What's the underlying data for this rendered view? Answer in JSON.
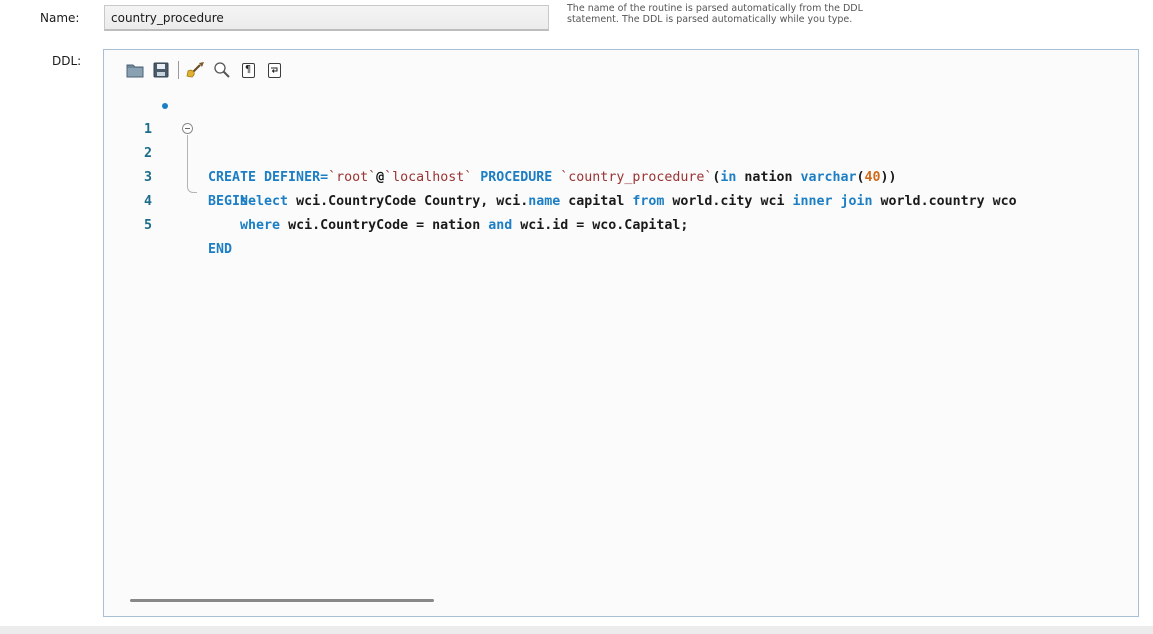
{
  "form": {
    "name_label": "Name:",
    "name_value": "country_procedure",
    "hint_line1": "The name of the routine is parsed automatically from the DDL",
    "hint_line2": "statement. The DDL is parsed automatically while you type.",
    "ddl_label": "DDL:"
  },
  "toolbar": {
    "buttons": [
      {
        "name": "open-file-icon"
      },
      {
        "name": "save-icon"
      },
      {
        "name": "beautify-icon"
      },
      {
        "name": "find-icon"
      },
      {
        "name": "show-whitespace-icon",
        "glyph": "¶"
      },
      {
        "name": "word-wrap-icon",
        "glyph": "⮐"
      }
    ]
  },
  "editor": {
    "line_numbers": [
      "1",
      "2",
      "3",
      "4",
      "5"
    ],
    "lines": [
      [
        {
          "t": "CREATE DEFINER=",
          "c": "kw"
        },
        {
          "t": "`root`",
          "c": "str"
        },
        {
          "t": "@",
          "c": "plain"
        },
        {
          "t": "`localhost`",
          "c": "str"
        },
        {
          "t": " PROCEDURE ",
          "c": "kw"
        },
        {
          "t": "`country_procedure`",
          "c": "str"
        },
        {
          "t": "(",
          "c": "plain"
        },
        {
          "t": "in",
          "c": "kw"
        },
        {
          "t": " nation ",
          "c": "plain"
        },
        {
          "t": "varchar",
          "c": "kw"
        },
        {
          "t": "(",
          "c": "plain"
        },
        {
          "t": "40",
          "c": "num"
        },
        {
          "t": "))",
          "c": "plain"
        }
      ],
      [
        {
          "t": "BEGIN",
          "c": "kw"
        }
      ],
      [
        {
          "t": "    ",
          "c": "plain"
        },
        {
          "t": "select",
          "c": "kw"
        },
        {
          "t": " wci.CountryCode Country, wci.",
          "c": "plain"
        },
        {
          "t": "name",
          "c": "kw"
        },
        {
          "t": " capital ",
          "c": "plain"
        },
        {
          "t": "from",
          "c": "kw"
        },
        {
          "t": " world.city wci ",
          "c": "plain"
        },
        {
          "t": "inner join",
          "c": "kw"
        },
        {
          "t": " world.country wco",
          "c": "plain"
        }
      ],
      [
        {
          "t": "    ",
          "c": "plain"
        },
        {
          "t": "where",
          "c": "kw"
        },
        {
          "t": " wci.CountryCode = nation ",
          "c": "plain"
        },
        {
          "t": "and",
          "c": "kw"
        },
        {
          "t": " wci.id = wco.Capital;",
          "c": "plain"
        }
      ],
      [
        {
          "t": "END",
          "c": "kw"
        }
      ]
    ]
  }
}
